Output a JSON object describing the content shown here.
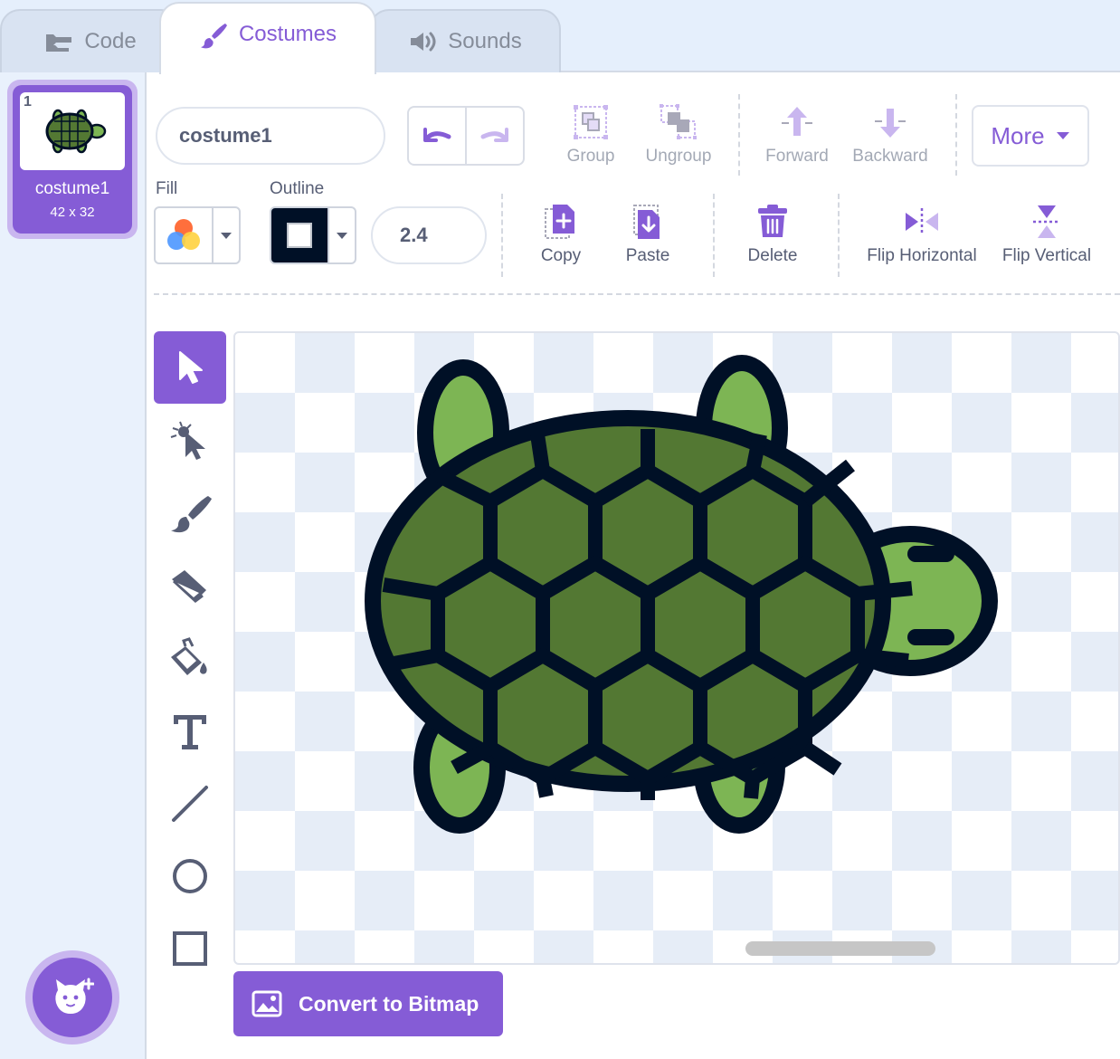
{
  "tabs": [
    {
      "label": "Code",
      "icon": "code-blocks-icon"
    },
    {
      "label": "Costumes",
      "icon": "paintbrush-icon"
    },
    {
      "label": "Sounds",
      "icon": "speaker-icon"
    }
  ],
  "costume_list": [
    {
      "number": "1",
      "name": "costume1",
      "size": "42 x 32"
    }
  ],
  "toolbar": {
    "costume_name": "costume1",
    "group": "Group",
    "ungroup": "Ungroup",
    "forward": "Forward",
    "backward": "Backward",
    "more": "More",
    "copy": "Copy",
    "paste": "Paste",
    "delete": "Delete",
    "flip_horizontal": "Flip Horizontal",
    "flip_vertical": "Flip Vertical"
  },
  "style": {
    "fill_label": "Fill",
    "outline_label": "Outline",
    "outline_width": "2.4",
    "outline_color": "#001026"
  },
  "tools": [
    "select-tool",
    "reshape-tool",
    "brush-tool",
    "eraser-tool",
    "fill-tool",
    "text-tool",
    "line-tool",
    "circle-tool",
    "rectangle-tool"
  ],
  "convert_button": "Convert to Bitmap",
  "colors": {
    "accent": "#855cd6",
    "turtle_shell": "#537833",
    "turtle_skin": "#7db554",
    "outline": "#001026"
  }
}
